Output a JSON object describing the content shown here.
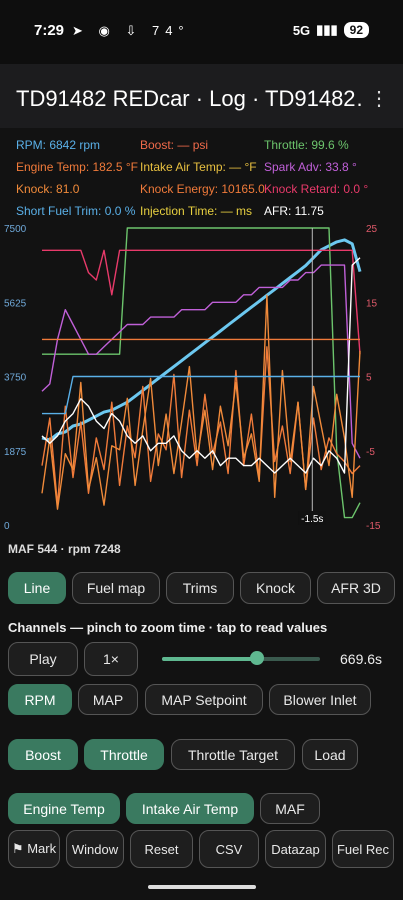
{
  "status": {
    "time": "7:29",
    "icons": "➤ ◉ ⇩ 74°",
    "network": "5G",
    "signal": "▮▮▮",
    "battery": "92"
  },
  "appbar": {
    "title": "TD91482 REDcar · Log · TD91482…",
    "menu_icon": "more-vert-icon"
  },
  "readouts": [
    {
      "id": "rpm",
      "text": "RPM: 6842 rpm",
      "color": "#5ab0e8"
    },
    {
      "id": "boost",
      "text": "Boost: — psi",
      "color": "#f06a4a"
    },
    {
      "id": "throttle",
      "text": "Throttle: 99.6 %",
      "color": "#6cc46c"
    },
    {
      "id": "engine_temp",
      "text": "Engine Temp: 182.5 °F",
      "color": "#f07a3a"
    },
    {
      "id": "iat",
      "text": "Intake Air Temp: — °F",
      "color": "#e8c040"
    },
    {
      "id": "spark",
      "text": "Spark Adv: 33.8 °",
      "color": "#c060d8"
    },
    {
      "id": "knock",
      "text": "Knock: 81.0",
      "color": "#f08a3a"
    },
    {
      "id": "knock_energy",
      "text": "Knock Energy: 10165.0",
      "color": "#f07a3a"
    },
    {
      "id": "knock_retard",
      "text": "Knock Retard: 0.0 °",
      "color": "#e83a6a"
    },
    {
      "id": "stft",
      "text": "Short Fuel Trim: 0.0 %",
      "color": "#5ab0e8"
    },
    {
      "id": "inj",
      "text": "Injection Time: — ms",
      "color": "#e8d040"
    },
    {
      "id": "afr",
      "text": "AFR: 11.75",
      "color": "#ffffff"
    }
  ],
  "chart_data": {
    "type": "line",
    "left_axis_ticks": [
      "7500",
      "5625",
      "3750",
      "1875",
      "0"
    ],
    "right_axis_ticks": [
      "25",
      "15",
      "5",
      "-5",
      "-15"
    ],
    "ylim_left": [
      0,
      7500
    ],
    "ylim_right": [
      -15,
      25
    ],
    "cursor_label": "-1.5s",
    "series": [
      {
        "name": "RPM",
        "color": "#6cc8f0",
        "axis": "left",
        "values": [
          2200,
          2150,
          2300,
          2350,
          2500,
          2550,
          2650,
          2750,
          2850,
          2900,
          3000,
          3100,
          3250,
          3400,
          3550,
          3700,
          3850,
          4000,
          4150,
          4300,
          4450,
          4600,
          4750,
          4900,
          5050,
          5200,
          5350,
          5500,
          5650,
          5800,
          5950,
          6100,
          6250,
          6400,
          6550,
          6750,
          6950,
          7050,
          7150,
          7200,
          7100,
          6400
        ]
      },
      {
        "name": "Throttle",
        "color": "#6cc46c",
        "axis": "right",
        "values": [
          8,
          8,
          8,
          8,
          8,
          8,
          8,
          8,
          8,
          8,
          8,
          25,
          25,
          25,
          25,
          25,
          25,
          25,
          25,
          25,
          25,
          25,
          25,
          25,
          25,
          25,
          25,
          25,
          25,
          25,
          25,
          25,
          25,
          25,
          25,
          25,
          25,
          25,
          -5,
          -14,
          -14,
          -12
        ]
      },
      {
        "name": "Spark Adv",
        "color": "#c060d8",
        "axis": "right",
        "values": [
          3,
          4,
          10,
          14,
          12,
          10,
          8,
          8,
          9,
          10,
          11,
          12,
          12,
          12,
          13,
          13,
          13,
          13,
          14,
          14,
          14,
          14,
          15,
          15,
          15,
          15,
          16,
          16,
          17,
          17,
          17,
          17,
          18,
          18,
          19,
          19,
          20,
          20,
          20,
          20,
          -4,
          -6
        ]
      },
      {
        "name": "Knock Retard",
        "color": "#e83a6a",
        "axis": "right",
        "values": [
          22,
          22,
          22,
          22,
          22,
          22,
          19,
          18,
          22,
          16,
          22,
          22,
          22,
          22,
          22,
          22,
          22,
          22,
          22,
          22,
          22,
          22,
          22,
          22,
          22,
          22,
          22,
          22,
          22,
          22,
          22,
          22,
          22,
          22,
          22,
          22,
          22,
          22,
          22,
          22,
          22,
          8
        ]
      },
      {
        "name": "Knock Energy",
        "color": "#f07a3a",
        "axis": "left",
        "values": [
          1500,
          2700,
          500,
          3000,
          1200,
          2600,
          800,
          2200,
          1400,
          3100,
          1000,
          2500,
          1700,
          3500,
          1100,
          2300,
          1900,
          3800,
          1200,
          2900,
          1500,
          3300,
          1800,
          2600,
          1300,
          3900,
          1500,
          2800,
          1200,
          4500,
          1600,
          2500,
          1300,
          3100,
          900,
          2700,
          1400,
          2200,
          1800,
          1600,
          1300,
          1500
        ]
      },
      {
        "name": "Knock",
        "color": "#f08a3a",
        "axis": "left",
        "values": [
          800,
          2200,
          400,
          1800,
          1400,
          3600,
          900,
          1700,
          500,
          2000,
          1900,
          3200,
          1000,
          2400,
          3700,
          1500,
          2800,
          1300,
          2600,
          4000,
          1700,
          2900,
          1400,
          3000,
          2000,
          3600,
          1700,
          2300,
          1100,
          5800,
          700,
          3900,
          1600,
          3100,
          900,
          3500,
          2500,
          1500,
          3300,
          2200,
          700,
          4400
        ]
      },
      {
        "name": "AFR",
        "color": "#ffffff",
        "axis": "right",
        "values": [
          -3,
          -4,
          -3,
          -1,
          0,
          2,
          1,
          -1,
          -2,
          0,
          -1,
          -3,
          -4,
          -3,
          -5,
          -4,
          -4,
          -3,
          -5,
          -6,
          -5,
          -6,
          -5,
          -7,
          -6,
          -6,
          -7,
          -7,
          -6,
          -7,
          -8,
          -7,
          -6,
          -7,
          -8,
          -6,
          -7,
          -5,
          -6,
          -8,
          20,
          21
        ]
      },
      {
        "name": "Short Fuel Trim",
        "color": "#5ab0e8",
        "axis": "right",
        "values": [
          0,
          0,
          0,
          0,
          5,
          5,
          5,
          5,
          5,
          5,
          5,
          5,
          5,
          5,
          5,
          5,
          5,
          5,
          5,
          5,
          5,
          5,
          5,
          5,
          5,
          5,
          5,
          5,
          5,
          5,
          5,
          5,
          5,
          5,
          5,
          5,
          5,
          5,
          5,
          5,
          5,
          5
        ]
      },
      {
        "name": "Engine Temp",
        "color": "#f07a3a",
        "axis": "right",
        "values": [
          10,
          10,
          10,
          10,
          10,
          10,
          10,
          10,
          10,
          10,
          10,
          10,
          10,
          10,
          10,
          10,
          10,
          10,
          10,
          10,
          10,
          10,
          10,
          10,
          10,
          10,
          10,
          10,
          10,
          10,
          10,
          10,
          10,
          10,
          10,
          10,
          10,
          10,
          10,
          10,
          10,
          10
        ]
      }
    ]
  },
  "footer": {
    "text": "MAF 544  ·  rpm 7248"
  },
  "view_buttons": [
    "Line",
    "Fuel map",
    "Trims",
    "Knock",
    "AFR 3D"
  ],
  "hint": "Channels — pinch to zoom time · tap to read values",
  "playback": {
    "play": "Play",
    "speed": "1×",
    "time": "669.6s",
    "progress": 0.6
  },
  "channel_rows": [
    [
      "RPM",
      "MAP",
      "MAP Setpoint",
      "Blower Inlet"
    ],
    [
      "Boost",
      "Throttle",
      "Throttle Target",
      "Load"
    ],
    [
      "Engine Temp",
      "Intake Air Temp",
      "MAF"
    ]
  ],
  "channel_states": [
    [
      true,
      false,
      false,
      false
    ],
    [
      true,
      true,
      false,
      false
    ],
    [
      true,
      true,
      false
    ]
  ],
  "actions": [
    "⚑ Mark",
    "Window",
    "Reset",
    "CSV",
    "Datazap",
    "Fuel Rec"
  ]
}
